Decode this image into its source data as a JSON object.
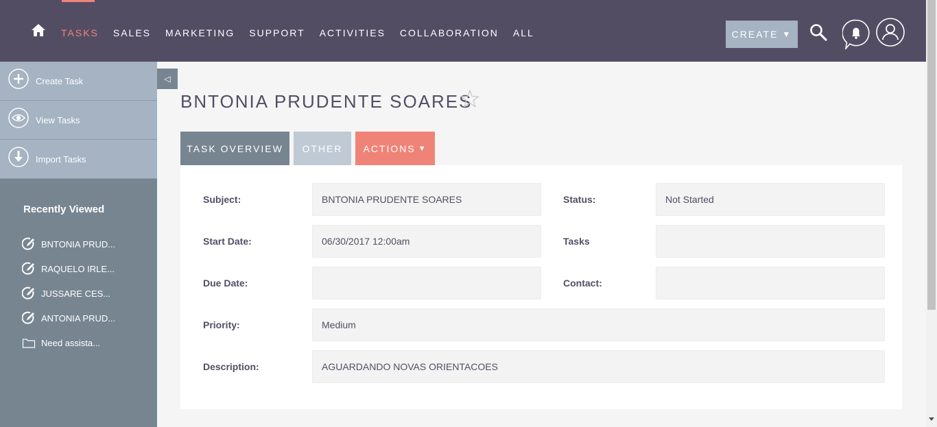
{
  "nav": {
    "items": [
      "TASKS",
      "SALES",
      "MARKETING",
      "SUPPORT",
      "ACTIVITIES",
      "COLLABORATION",
      "ALL"
    ],
    "create_label": "CREATE"
  },
  "sidebar": {
    "actions": [
      {
        "label": "Create Task",
        "icon": "plus-circle-icon"
      },
      {
        "label": "View Tasks",
        "icon": "eye-icon"
      },
      {
        "label": "Import Tasks",
        "icon": "download-icon"
      }
    ],
    "recently_viewed_title": "Recently Viewed",
    "recent": [
      {
        "label": "BNTONIA PRUD...",
        "icon": "task-edit-icon"
      },
      {
        "label": "RAQUELO IRLE...",
        "icon": "task-edit-icon"
      },
      {
        "label": "JUSSARE CES...",
        "icon": "task-edit-icon"
      },
      {
        "label": "ANTONIA PRUD...",
        "icon": "task-edit-icon"
      },
      {
        "label": "Need assista...",
        "icon": "folder-icon"
      }
    ]
  },
  "record": {
    "title": "BNTONIA PRUDENTE SOARES"
  },
  "tabs": {
    "overview": "TASK OVERVIEW",
    "other": "OTHER",
    "actions": "ACTIONS"
  },
  "fields": {
    "subject_label": "Subject:",
    "subject_value": "BNTONIA PRUDENTE SOARES",
    "status_label": "Status:",
    "status_value": "Not Started",
    "start_date_label": "Start Date:",
    "start_date_value": "06/30/2017 12:00am",
    "tasks_label": "Tasks",
    "tasks_value": "",
    "due_date_label": "Due Date:",
    "due_date_value": "",
    "contact_label": "Contact:",
    "contact_value": "",
    "priority_label": "Priority:",
    "priority_value": "Medium",
    "description_label": "Description:",
    "description_value": "AGUARDANDO NOVAS ORIENTACOES"
  },
  "colors": {
    "nav_bg": "#534d64",
    "accent": "#f08377",
    "sidebar_bg": "#778591",
    "sidebar_actions_bg": "#a5b3c2"
  }
}
